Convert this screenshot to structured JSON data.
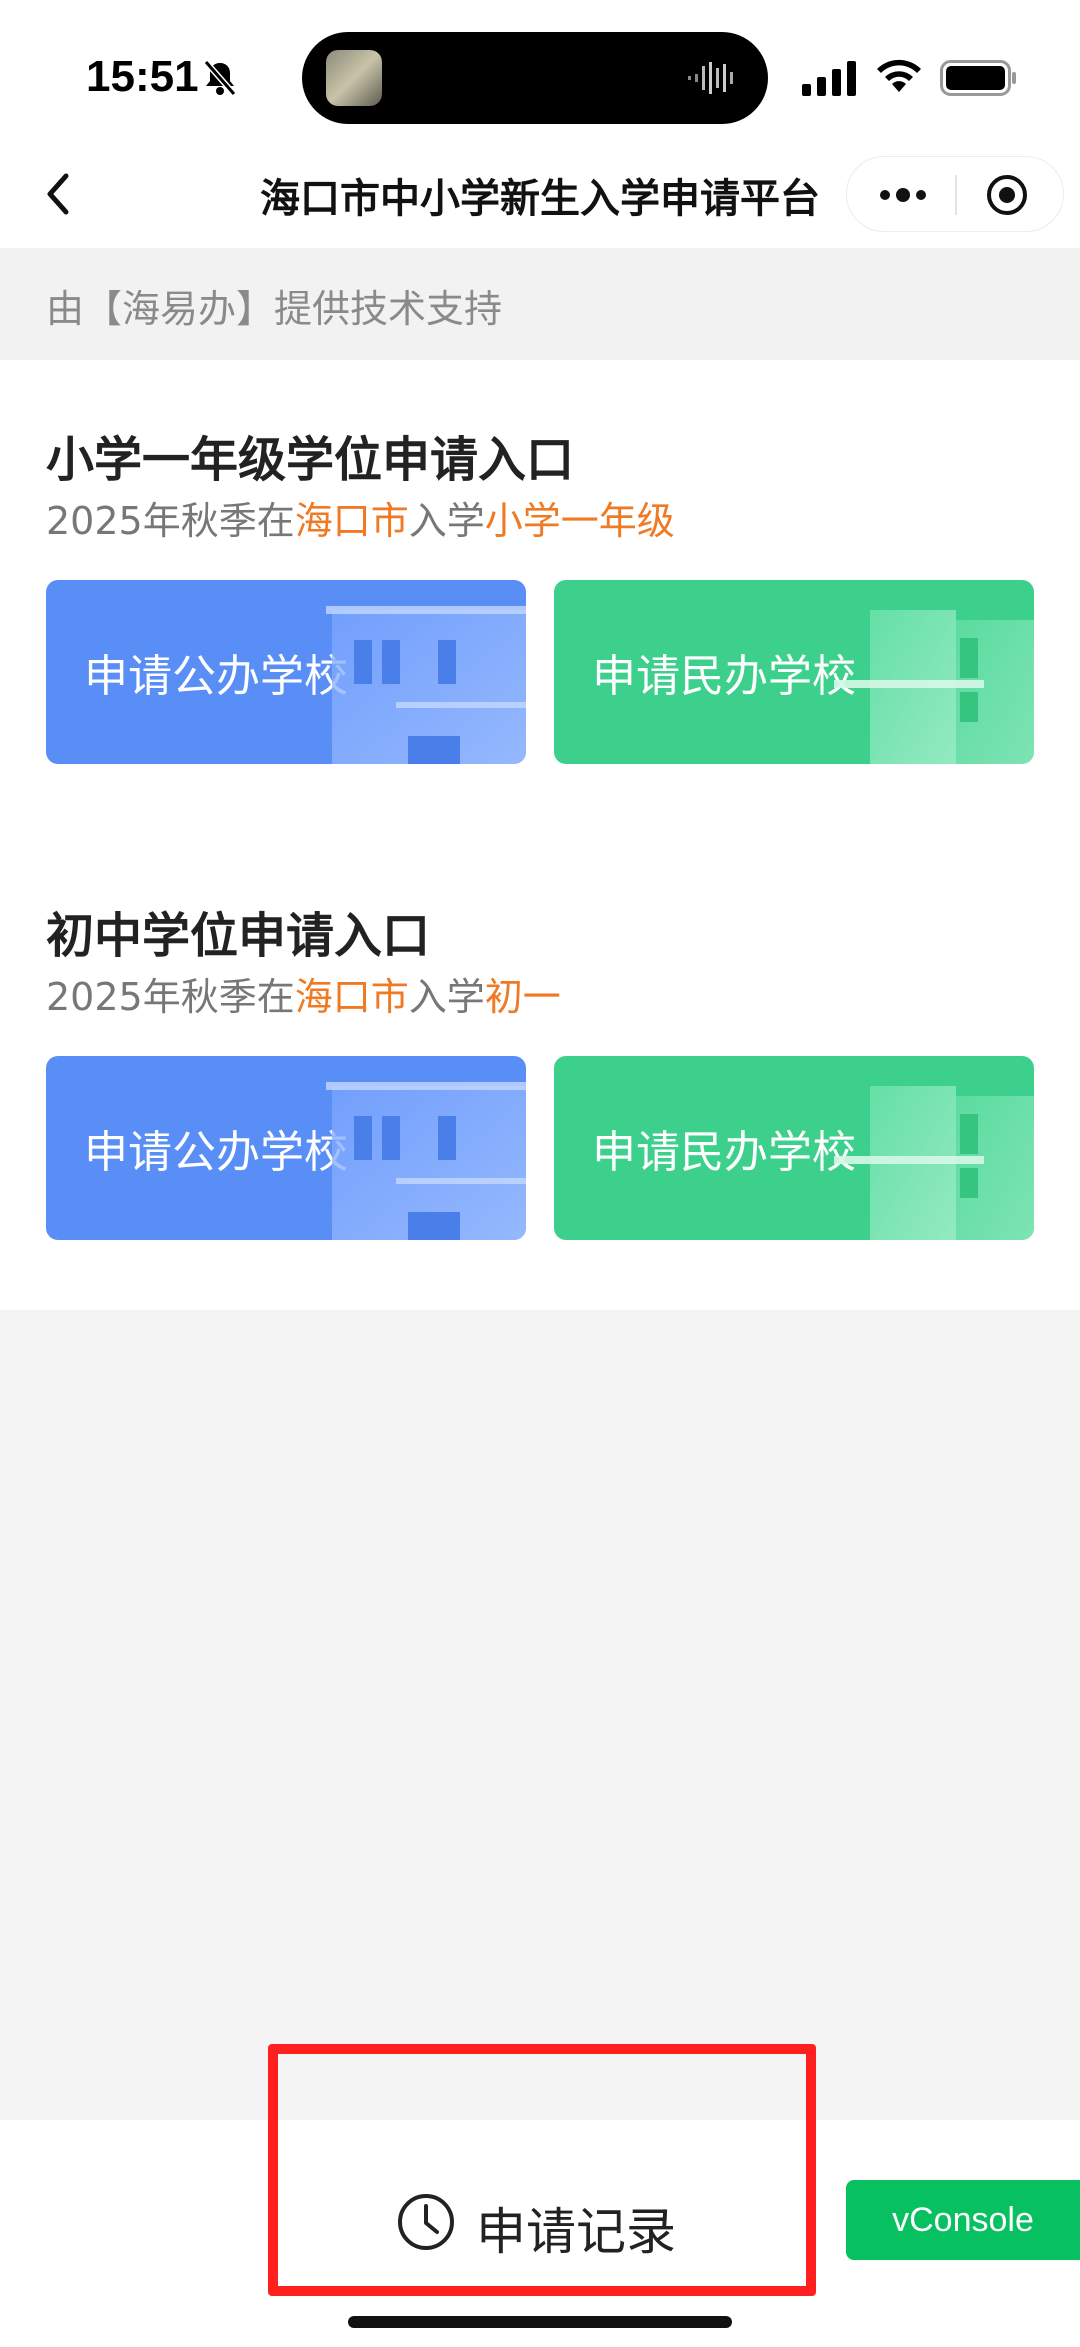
{
  "status_bar": {
    "time": "15:51",
    "icons": [
      "bell-slash-icon",
      "cellular-signal-icon",
      "wifi-icon",
      "battery-icon"
    ]
  },
  "nav": {
    "title": "海口市中小学新生入学申请平台",
    "icons": [
      "back-icon",
      "more-icon",
      "target-icon"
    ]
  },
  "support": {
    "text": "由【海易办】提供技术支持"
  },
  "sections": [
    {
      "title": "小学一年级学位申请入口",
      "subtitle_parts": [
        "2025年秋季在",
        "海口市",
        "入学",
        "小学一年级"
      ],
      "public_label": "申请公办学校",
      "private_label": "申请民办学校"
    },
    {
      "title": "初中学位申请入口",
      "subtitle_parts": [
        "2025年秋季在",
        "海口市",
        "入学",
        "初一"
      ],
      "public_label": "申请公办学校",
      "private_label": "申请民办学校"
    }
  ],
  "bottom": {
    "history_label": "申请记录",
    "history_icon": "clock-icon"
  },
  "vconsole_label": "vConsole",
  "colors": {
    "public": "#5a8ef7",
    "private": "#3dd08c",
    "highlight": "#f07a23",
    "annotation": "#ff1f1f",
    "vconsole": "#07c160"
  }
}
